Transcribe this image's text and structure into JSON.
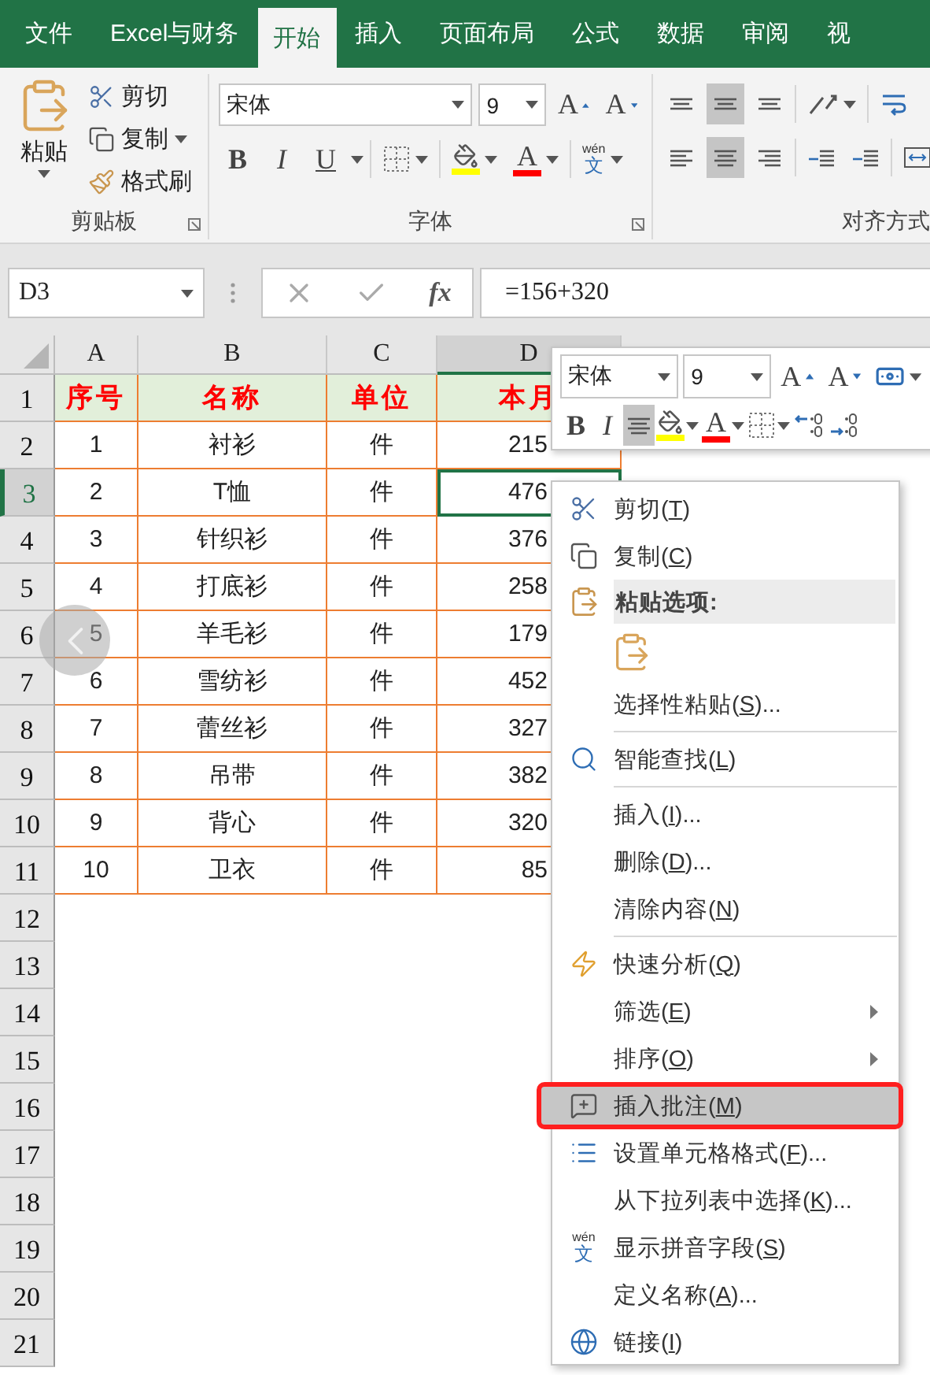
{
  "tabs": [
    {
      "label": "文件",
      "selected": false
    },
    {
      "label": "Excel与财务",
      "selected": false
    },
    {
      "label": "开始",
      "selected": true
    },
    {
      "label": "插入",
      "selected": false
    },
    {
      "label": "页面布局",
      "selected": false
    },
    {
      "label": "公式",
      "selected": false
    },
    {
      "label": "数据",
      "selected": false
    },
    {
      "label": "审阅",
      "selected": false
    },
    {
      "label": "视",
      "selected": false
    }
  ],
  "ribbon": {
    "clipboard": {
      "paste": "粘贴",
      "group": "剪贴板",
      "items": [
        {
          "label": "剪切",
          "dropdown": false
        },
        {
          "label": "复制",
          "dropdown": true
        },
        {
          "label": "格式刷",
          "dropdown": false
        }
      ]
    },
    "font": {
      "group": "字体",
      "name": "宋体",
      "size": "9",
      "grow": "A",
      "shrink": "A",
      "buttons": [
        {
          "kind": "bold",
          "label": "B"
        },
        {
          "kind": "italic",
          "label": "I"
        },
        {
          "kind": "underline",
          "label": "U"
        },
        {
          "kind": "border"
        },
        {
          "kind": "fill",
          "color": "#ffff00"
        },
        {
          "kind": "font-color",
          "label": "A",
          "color": "#ff0000"
        },
        {
          "kind": "phonetic",
          "top": "wén",
          "bottom": "文"
        }
      ]
    },
    "alignment": {
      "group": "对齐方式",
      "rows": [
        [
          {
            "kind": "top",
            "selected": false
          },
          {
            "kind": "middle",
            "selected": true
          },
          {
            "kind": "bottom",
            "selected": false
          },
          {
            "kind": "orientation",
            "selected": false
          },
          {
            "kind": "wrap",
            "selected": false
          }
        ],
        [
          {
            "kind": "left",
            "selected": false
          },
          {
            "kind": "center",
            "selected": true
          },
          {
            "kind": "right",
            "selected": false
          },
          {
            "kind": "outdent",
            "selected": false
          },
          {
            "kind": "indent",
            "selected": false
          },
          {
            "kind": "merge",
            "selected": false
          }
        ]
      ]
    }
  },
  "formula_bar": {
    "name_box": "D3",
    "fx": "fx",
    "formula": "=156+320"
  },
  "sheet": {
    "columns": [
      {
        "label": "A",
        "selected": false
      },
      {
        "label": "B",
        "selected": false
      },
      {
        "label": "C",
        "selected": false
      },
      {
        "label": "D",
        "selected": true
      }
    ],
    "rows": [
      {
        "label": "1",
        "kind": "header",
        "selected": false,
        "cells": [
          "序号",
          "名称",
          "单位",
          "本月"
        ]
      },
      {
        "label": "2",
        "kind": "data",
        "selected": false,
        "cells": [
          "1",
          "衬衫",
          "件",
          "215"
        ]
      },
      {
        "label": "3",
        "kind": "data",
        "selected": true,
        "cells": [
          "2",
          "T恤",
          "件",
          "476"
        ]
      },
      {
        "label": "4",
        "kind": "data",
        "selected": false,
        "cells": [
          "3",
          "针织衫",
          "件",
          "376"
        ]
      },
      {
        "label": "5",
        "kind": "data",
        "selected": false,
        "cells": [
          "4",
          "打底衫",
          "件",
          "258"
        ]
      },
      {
        "label": "6",
        "kind": "data",
        "selected": false,
        "cells": [
          "5",
          "羊毛衫",
          "件",
          "179"
        ]
      },
      {
        "label": "7",
        "kind": "data",
        "selected": false,
        "cells": [
          "6",
          "雪纺衫",
          "件",
          "452"
        ]
      },
      {
        "label": "8",
        "kind": "data",
        "selected": false,
        "cells": [
          "7",
          "蕾丝衫",
          "件",
          "327"
        ]
      },
      {
        "label": "9",
        "kind": "data",
        "selected": false,
        "cells": [
          "8",
          "吊带",
          "件",
          "382"
        ]
      },
      {
        "label": "10",
        "kind": "data",
        "selected": false,
        "cells": [
          "9",
          "背心",
          "件",
          "320"
        ]
      },
      {
        "label": "11",
        "kind": "data",
        "selected": false,
        "cells": [
          "10",
          "卫衣",
          "件",
          "85"
        ]
      },
      {
        "label": "12",
        "kind": "empty",
        "selected": false
      },
      {
        "label": "13",
        "kind": "empty",
        "selected": false
      },
      {
        "label": "14",
        "kind": "empty",
        "selected": false
      },
      {
        "label": "15",
        "kind": "empty",
        "selected": false
      },
      {
        "label": "16",
        "kind": "empty",
        "selected": false
      },
      {
        "label": "17",
        "kind": "empty",
        "selected": false
      },
      {
        "label": "18",
        "kind": "empty",
        "selected": false
      },
      {
        "label": "19",
        "kind": "empty",
        "selected": false
      },
      {
        "label": "20",
        "kind": "empty",
        "selected": false
      },
      {
        "label": "21",
        "kind": "empty",
        "selected": false
      }
    ]
  },
  "mini_toolbar": {
    "font": "宋体",
    "size": "9",
    "grow": "A",
    "shrink": "A",
    "buttons": [
      {
        "kind": "bold",
        "label": "B",
        "selected": false
      },
      {
        "kind": "italic",
        "label": "I",
        "selected": false
      },
      {
        "kind": "center",
        "selected": true
      },
      {
        "kind": "fill",
        "color": "#ffff00",
        "selected": false
      },
      {
        "kind": "font-color",
        "label": "A",
        "color": "#ff0000",
        "selected": false
      },
      {
        "kind": "border",
        "selected": false
      },
      {
        "kind": "increase-decimal",
        "selected": false
      },
      {
        "kind": "decrease-decimal",
        "selected": false
      }
    ]
  },
  "context_menu": [
    {
      "kind": "item",
      "before": "剪切(",
      "key": "T",
      "after": ")",
      "submenu": false,
      "selected": false
    },
    {
      "kind": "item",
      "before": "复制(",
      "key": "C",
      "after": ")",
      "submenu": false,
      "selected": false
    },
    {
      "kind": "header",
      "label": "粘贴选项:"
    },
    {
      "kind": "paste-options"
    },
    {
      "kind": "item",
      "before": "选择性粘贴(",
      "key": "S",
      "after": ")...",
      "submenu": false,
      "selected": false
    },
    {
      "kind": "separator"
    },
    {
      "kind": "item",
      "before": "智能查找(",
      "key": "L",
      "after": ")",
      "submenu": false,
      "selected": false
    },
    {
      "kind": "separator"
    },
    {
      "kind": "item",
      "before": "插入(",
      "key": "I",
      "after": ")...",
      "submenu": false,
      "selected": false
    },
    {
      "kind": "item",
      "before": "删除(",
      "key": "D",
      "after": ")...",
      "submenu": false,
      "selected": false
    },
    {
      "kind": "item",
      "before": "清除内容(",
      "key": "N",
      "after": ")",
      "submenu": false,
      "selected": false
    },
    {
      "kind": "separator"
    },
    {
      "kind": "item",
      "before": "快速分析(",
      "key": "Q",
      "after": ")",
      "submenu": false,
      "selected": false
    },
    {
      "kind": "item",
      "before": "筛选(",
      "key": "E",
      "after": ")",
      "submenu": true,
      "selected": false
    },
    {
      "kind": "item",
      "before": "排序(",
      "key": "O",
      "after": ")",
      "submenu": true,
      "selected": false
    },
    {
      "kind": "item",
      "before": "插入批注(",
      "key": "M",
      "after": ")",
      "submenu": false,
      "selected": true
    },
    {
      "kind": "item",
      "before": "设置单元格格式(",
      "key": "F",
      "after": ")...",
      "submenu": false,
      "selected": false
    },
    {
      "kind": "item",
      "before": "从下拉列表中选择(",
      "key": "K",
      "after": ")...",
      "submenu": false,
      "selected": false
    },
    {
      "kind": "item",
      "icon_top": "wén",
      "icon_bottom": "文",
      "before": "显示拼音字段(",
      "key": "S",
      "after": ")",
      "submenu": false,
      "selected": false
    },
    {
      "kind": "item",
      "before": "定义名称(",
      "key": "A",
      "after": ")...",
      "submenu": false,
      "selected": false
    },
    {
      "kind": "item",
      "before": "链接(",
      "key": "I",
      "after": ")",
      "submenu": false,
      "selected": false
    }
  ]
}
